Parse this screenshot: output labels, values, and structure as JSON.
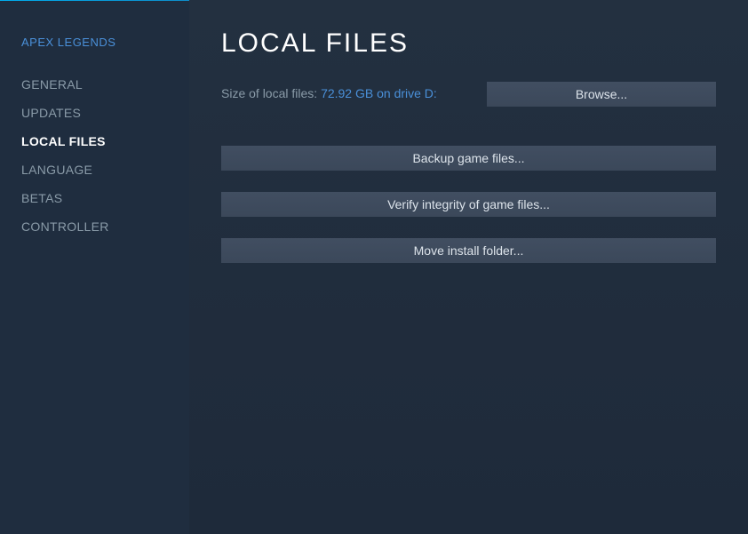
{
  "sidebar": {
    "gameTitle": "APEX LEGENDS",
    "items": [
      {
        "label": "GENERAL",
        "active": false
      },
      {
        "label": "UPDATES",
        "active": false
      },
      {
        "label": "LOCAL FILES",
        "active": true
      },
      {
        "label": "LANGUAGE",
        "active": false
      },
      {
        "label": "BETAS",
        "active": false
      },
      {
        "label": "CONTROLLER",
        "active": false
      }
    ]
  },
  "main": {
    "title": "LOCAL FILES",
    "sizeLabel": "Size of local files: ",
    "sizeValue": "72.92 GB on drive D:",
    "browseLabel": "Browse...",
    "backupLabel": "Backup game files...",
    "verifyLabel": "Verify integrity of game files...",
    "moveLabel": "Move install folder..."
  }
}
